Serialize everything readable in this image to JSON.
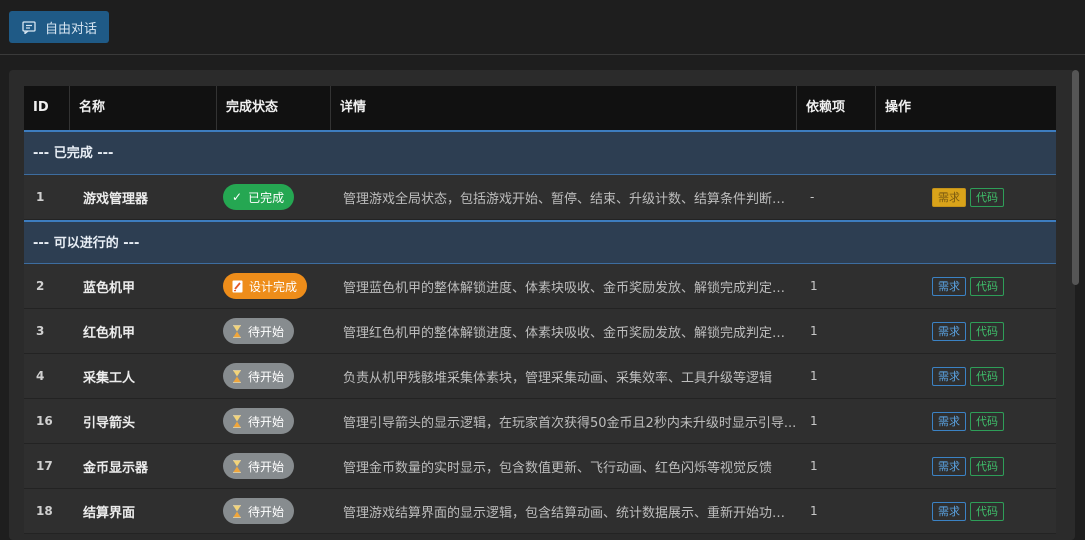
{
  "header": {
    "chat_button_label": "自由对话"
  },
  "table": {
    "columns": [
      "ID",
      "名称",
      "完成状态",
      "详情",
      "依赖项",
      "操作"
    ],
    "groups": [
      {
        "label": "--- 已完成 ---",
        "rows": [
          {
            "id": "1",
            "name": "游戏管理器",
            "status": "已完成",
            "status_type": "done",
            "detail": "管理游戏全局状态，包括游戏开始、暂停、结束、升级计数、结算条件判断等...",
            "dep": "-",
            "req_label": "需求",
            "code_label": "代码",
            "req_active": true
          }
        ]
      },
      {
        "label": "--- 可以进行的 ---",
        "rows": [
          {
            "id": "2",
            "name": "蓝色机甲",
            "status": "设计完成",
            "status_type": "design",
            "detail": "管理蓝色机甲的整体解锁进度、体素块吸收、金币奖励发放、解锁完成判定等...",
            "dep": "1",
            "req_label": "需求",
            "code_label": "代码",
            "req_active": false
          },
          {
            "id": "3",
            "name": "红色机甲",
            "status": "待开始",
            "status_type": "pending",
            "detail": "管理红色机甲的整体解锁进度、体素块吸收、金币奖励发放、解锁完成判定等...",
            "dep": "1",
            "req_label": "需求",
            "code_label": "代码",
            "req_active": false
          },
          {
            "id": "4",
            "name": "采集工人",
            "status": "待开始",
            "status_type": "pending",
            "detail": "负责从机甲残骸堆采集体素块，管理采集动画、采集效率、工具升级等逻辑",
            "dep": "1",
            "req_label": "需求",
            "code_label": "代码",
            "req_active": false
          },
          {
            "id": "16",
            "name": "引导箭头",
            "status": "待开始",
            "status_type": "pending",
            "detail": "管理引导箭头的显示逻辑，在玩家首次获得50金币且2秒内未升级时显示引导...",
            "dep": "1",
            "req_label": "需求",
            "code_label": "代码",
            "req_active": false
          },
          {
            "id": "17",
            "name": "金币显示器",
            "status": "待开始",
            "status_type": "pending",
            "detail": "管理金币数量的实时显示，包含数值更新、飞行动画、红色闪烁等视觉反馈",
            "dep": "1",
            "req_label": "需求",
            "code_label": "代码",
            "req_active": false
          },
          {
            "id": "18",
            "name": "结算界面",
            "status": "待开始",
            "status_type": "pending",
            "detail": "管理游戏结算界面的显示逻辑，包含结算动画、统计数据展示、重新开始功能...",
            "dep": "1",
            "req_label": "需求",
            "code_label": "代码",
            "req_active": false
          }
        ]
      }
    ]
  }
}
